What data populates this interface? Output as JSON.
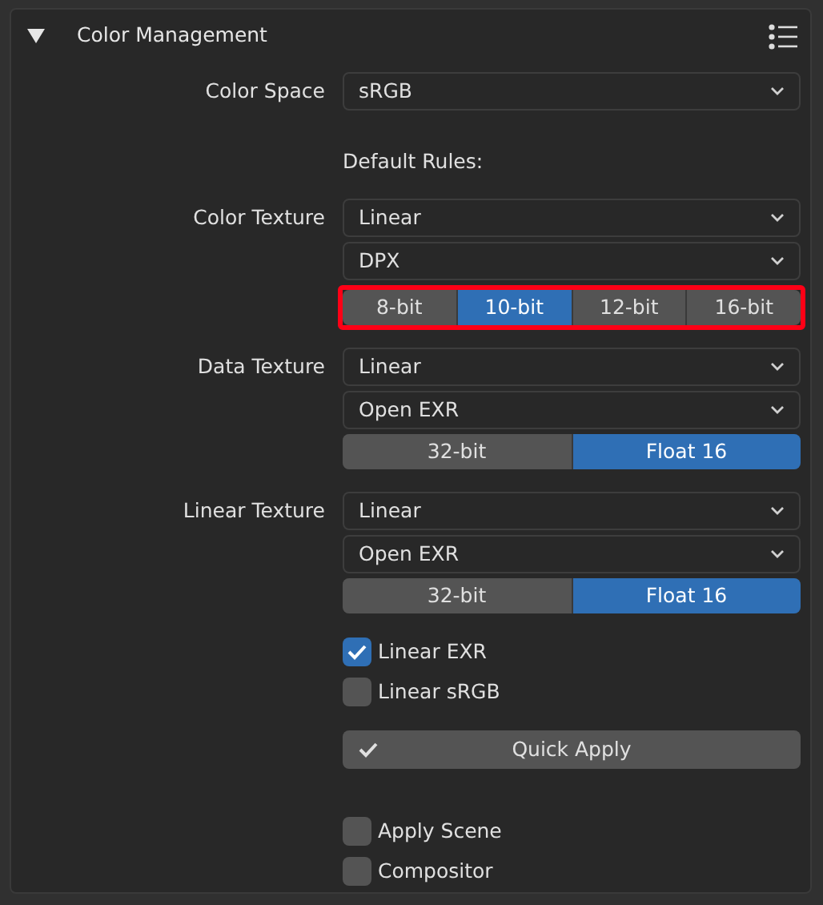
{
  "panel": {
    "title": "Color Management",
    "expanded": true
  },
  "color_space": {
    "label": "Color Space",
    "value": "sRGB"
  },
  "default_rules_label": "Default Rules:",
  "rules": [
    {
      "label": "Color Texture",
      "dropdowns": [
        "Linear",
        "DPX"
      ],
      "highlighted": true,
      "bit_depths": [
        {
          "label": "8-bit",
          "selected": false
        },
        {
          "label": "10-bit",
          "selected": true
        },
        {
          "label": "12-bit",
          "selected": false
        },
        {
          "label": "16-bit",
          "selected": false
        }
      ]
    },
    {
      "label": "Data Texture",
      "dropdowns": [
        "Linear",
        "Open EXR"
      ],
      "highlighted": false,
      "bit_depths": [
        {
          "label": "32-bit",
          "selected": false
        },
        {
          "label": "Float 16",
          "selected": true
        }
      ]
    },
    {
      "label": "Linear Texture",
      "dropdowns": [
        "Linear",
        "Open EXR"
      ],
      "highlighted": false,
      "bit_depths": [
        {
          "label": "32-bit",
          "selected": false
        },
        {
          "label": "Float 16",
          "selected": true
        }
      ]
    }
  ],
  "options": [
    {
      "label": "Linear EXR",
      "checked": true
    },
    {
      "label": "Linear sRGB",
      "checked": false
    }
  ],
  "quick_apply": {
    "label": "Quick Apply"
  },
  "targets": [
    {
      "label": "Apply Scene",
      "checked": false
    },
    {
      "label": "Compositor",
      "checked": false
    }
  ]
}
